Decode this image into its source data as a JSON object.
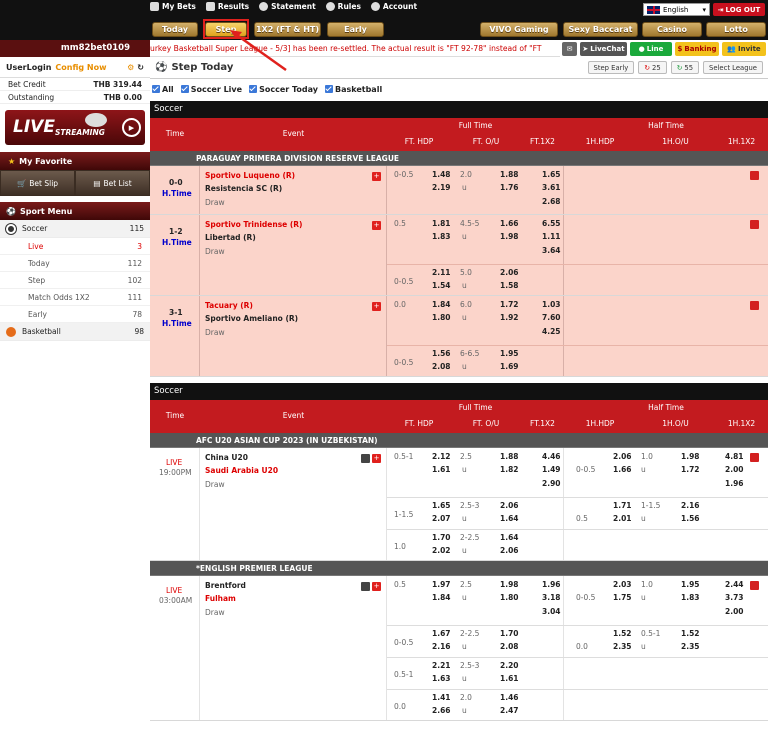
{
  "top_links": [
    "My Bets",
    "Results",
    "Statement",
    "Rules",
    "Account"
  ],
  "language": "English",
  "logout": "LOG OUT",
  "nav_left": [
    "Today",
    "Step",
    "1X2 (FT & HT)",
    "Early"
  ],
  "nav_right": [
    "VIVO Gaming",
    "Sexy Baccarat",
    "Casino",
    "Lotto"
  ],
  "username": "mm82bet0109",
  "ticker": "urkey Basketball Super League - 5/3] has been re-settled. The actual result is \"FT 92-78\" instead of \"FT",
  "right_btns": [
    "LiveChat",
    "Line",
    "Banking",
    "Invite"
  ],
  "sidebar": {
    "userlogin": "UserLogin",
    "config": "Config Now",
    "bet_credit_label": "Bet Credit",
    "bet_credit": "THB 319.44",
    "outstanding_label": "Outstanding",
    "outstanding": "THB 0.00",
    "live_big": "LIVE",
    "live_small": "STREAMING",
    "favorite": "My Favorite",
    "bet_slip": "Bet Slip",
    "bet_list": "Bet List",
    "sport_menu": "Sport Menu",
    "soccer": "Soccer",
    "soccer_count": "115",
    "sub": [
      {
        "label": "Live",
        "count": "3"
      },
      {
        "label": "Today",
        "count": "112"
      },
      {
        "label": "Step",
        "count": "102"
      },
      {
        "label": "Match Odds 1X2",
        "count": "111"
      },
      {
        "label": "Early",
        "count": "78"
      }
    ],
    "basketball": "Basketball",
    "basketball_count": "98"
  },
  "page_title": "Step Today",
  "step_btns": [
    "Step Early",
    "25",
    "55",
    "Select League"
  ],
  "filters": [
    "All",
    "Soccer Live",
    "Soccer Today",
    "Basketball"
  ],
  "header": {
    "sport": "Soccer",
    "time": "Time",
    "event": "Event",
    "full": "Full Time",
    "half": "Half Time",
    "ft_hdp": "FT. HDP",
    "ft_ou": "FT. O/U",
    "ft_1x2": "FT.1X2",
    "h_hdp": "1H.HDP",
    "h_ou": "1H.O/U",
    "h_1x2": "1H.1X2"
  },
  "section1": {
    "league": "PARAGUAY PRIMERA DIVISION RESERVE LEAGUE",
    "matches": [
      {
        "score": "0-0",
        "status": "H.Time",
        "home": "Sportivo Luqueno (R)",
        "away": "Resistencia SC (R)",
        "draw": "Draw",
        "rows": [
          {
            "hdp": "0-0.5",
            "h1": "1.48",
            "h2": "2.19",
            "ou": "2.0",
            "u": "u",
            "o1": "1.88",
            "o2": "1.76",
            "x1": "1.65",
            "x2": "3.61",
            "x3": "2.68"
          }
        ]
      },
      {
        "score": "1-2",
        "status": "H.Time",
        "home": "Sportivo Trinidense (R)",
        "away": "Libertad (R)",
        "draw": "Draw",
        "rows": [
          {
            "hdp": "0.5",
            "h1": "1.81",
            "h2": "1.83",
            "ou": "4.5-5",
            "u": "u",
            "o1": "1.66",
            "o2": "1.98",
            "x1": "6.55",
            "x2": "1.11",
            "x3": "3.64"
          },
          {
            "hdp": "0-0.5",
            "h1": "2.11",
            "h2": "1.54",
            "ou": "5.0",
            "u": "u",
            "o1": "2.06",
            "o2": "1.58"
          }
        ]
      },
      {
        "score": "3-1",
        "status": "H.Time",
        "home": "Tacuary (R)",
        "away": "Sportivo Ameliano (R)",
        "draw": "Draw",
        "rows": [
          {
            "hdp": "0.0",
            "h1": "1.84",
            "h2": "1.80",
            "ou": "6.0",
            "u": "u",
            "o1": "1.72",
            "o2": "1.92",
            "x1": "1.03",
            "x2": "7.60",
            "x3": "4.25"
          },
          {
            "hdp": "0-0.5",
            "h1": "1.56",
            "h2": "2.08",
            "ou": "6-6.5",
            "u": "u",
            "o1": "1.95",
            "o2": "1.69"
          }
        ]
      }
    ]
  },
  "section2": {
    "league1": "AFC U20 ASIAN CUP 2023 (IN UZBEKISTAN)",
    "m1": {
      "status": "LIVE",
      "time": "19:00PM",
      "home": "China U20",
      "away": "Saudi Arabia U20",
      "draw": "Draw",
      "rows": [
        {
          "hdp": "0.5-1",
          "h1": "2.12",
          "h2": "1.61",
          "ou": "2.5",
          "u": "u",
          "o1": "1.88",
          "o2": "1.82",
          "x1": "4.46",
          "x2": "1.49",
          "x3": "2.90",
          "hh": "0-0.5",
          "hh1": "2.06",
          "hh2": "1.66",
          "hou": "1.0",
          "hu": "u",
          "ho1": "1.98",
          "ho2": "1.72",
          "hx1": "4.81",
          "hx2": "2.00",
          "hx3": "1.96"
        },
        {
          "hdp": "1-1.5",
          "h1": "1.65",
          "h2": "2.07",
          "ou": "2.5-3",
          "u": "u",
          "o1": "2.06",
          "o2": "1.64",
          "hh": "0.5",
          "hh1": "1.71",
          "hh2": "2.01",
          "hou": "1-1.5",
          "hu": "u",
          "ho1": "2.16",
          "ho2": "1.56"
        },
        {
          "hdp": "1.0",
          "h1": "1.70",
          "h2": "2.02",
          "ou": "2-2.5",
          "u": "u",
          "o1": "1.64",
          "o2": "2.06"
        }
      ]
    },
    "league2": "*ENGLISH PREMIER LEAGUE",
    "m2": {
      "status": "LIVE",
      "time": "03:00AM",
      "home": "Brentford",
      "away": "Fulham",
      "draw": "Draw",
      "rows": [
        {
          "hdp": "0.5",
          "h1": "1.97",
          "h2": "1.84",
          "ou": "2.5",
          "u": "u",
          "o1": "1.98",
          "o2": "1.80",
          "x1": "1.96",
          "x2": "3.18",
          "x3": "3.04",
          "hh": "0-0.5",
          "hh1": "2.03",
          "hh2": "1.75",
          "hou": "1.0",
          "hu": "u",
          "ho1": "1.95",
          "ho2": "1.83",
          "hx1": "2.44",
          "hx2": "3.73",
          "hx3": "2.00"
        },
        {
          "hdp": "0-0.5",
          "h1": "1.67",
          "h2": "2.16",
          "ou": "2-2.5",
          "u": "u",
          "o1": "1.70",
          "o2": "2.08",
          "hh": "0.0",
          "hh1": "1.52",
          "hh2": "2.35",
          "hou": "0.5-1",
          "hu": "u",
          "ho1": "1.52",
          "ho2": "2.35"
        },
        {
          "hdp": "0.5-1",
          "h1": "2.21",
          "h2": "1.63",
          "ou": "2.5-3",
          "u": "u",
          "o1": "2.20",
          "o2": "1.61"
        },
        {
          "hdp": "0.0",
          "h1": "1.41",
          "h2": "2.66",
          "ou": "2.0",
          "u": "u",
          "o1": "1.46",
          "o2": "2.47"
        }
      ]
    }
  }
}
